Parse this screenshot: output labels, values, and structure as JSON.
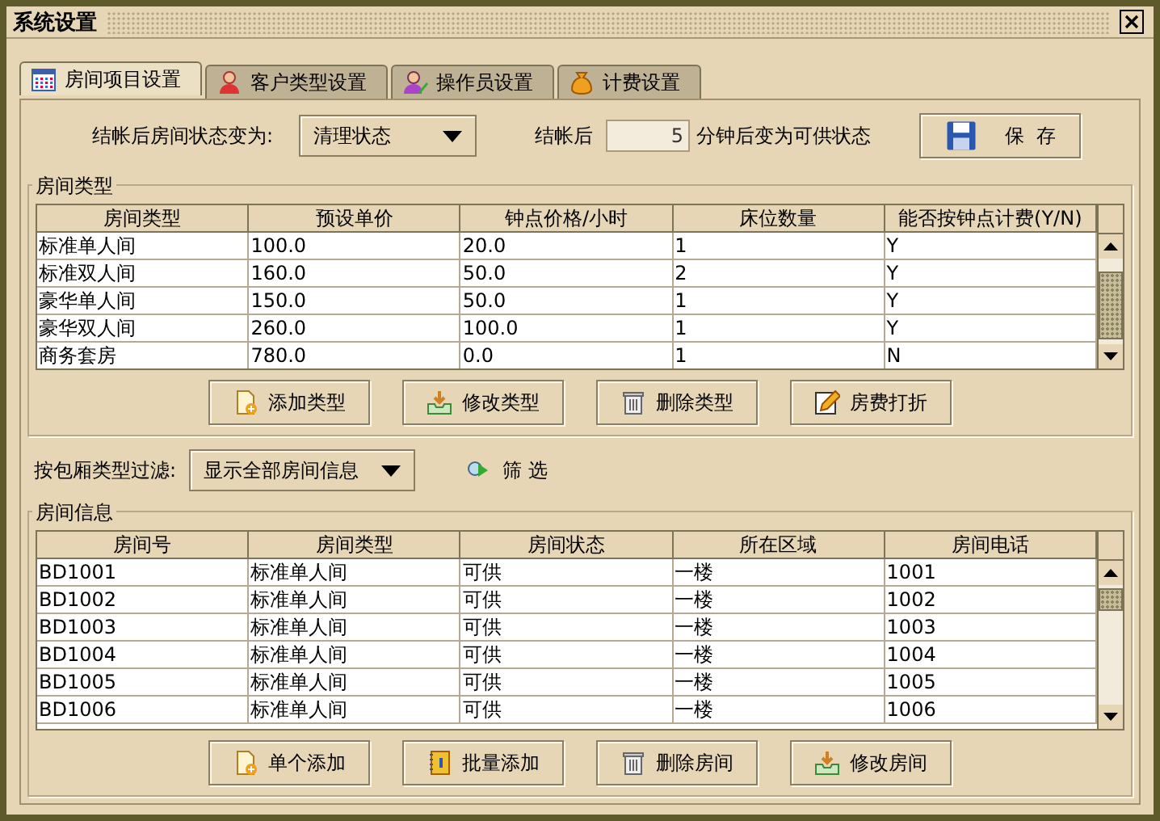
{
  "window": {
    "title": "系统设置"
  },
  "tabs": [
    {
      "label": "房间项目设置",
      "selected": true
    },
    {
      "label": "客户类型设置",
      "selected": false
    },
    {
      "label": "操作员设置",
      "selected": false
    },
    {
      "label": "计费设置",
      "selected": false
    }
  ],
  "checkout": {
    "status_label": "结帐后房间状态变为:",
    "status_value": "清理状态",
    "minutes_prefix": "结帐后",
    "minutes_value": "5",
    "minutes_suffix": "分钟后变为可供状态",
    "save_button": "保  存"
  },
  "room_types": {
    "title": "房间类型",
    "columns": [
      "房间类型",
      "预设单价",
      "钟点价格/小时",
      "床位数量",
      "能否按钟点计费(Y/N)"
    ],
    "rows": [
      [
        "标准单人间",
        "100.0",
        "20.0",
        "1",
        "Y"
      ],
      [
        "标准双人间",
        "160.0",
        "50.0",
        "2",
        "Y"
      ],
      [
        "豪华单人间",
        "150.0",
        "50.0",
        "1",
        "Y"
      ],
      [
        "豪华双人间",
        "260.0",
        "100.0",
        "1",
        "Y"
      ],
      [
        "商务套房",
        "780.0",
        "0.0",
        "1",
        "N"
      ]
    ],
    "buttons": [
      "添加类型",
      "修改类型",
      "删除类型",
      "房费打折"
    ]
  },
  "filter": {
    "label": "按包厢类型过滤:",
    "value": "显示全部房间信息",
    "button": "筛 选"
  },
  "rooms": {
    "title": "房间信息",
    "columns": [
      "房间号",
      "房间类型",
      "房间状态",
      "所在区域",
      "房间电话"
    ],
    "rows": [
      [
        "BD1001",
        "标准单人间",
        "可供",
        "一楼",
        "1001"
      ],
      [
        "BD1002",
        "标准单人间",
        "可供",
        "一楼",
        "1002"
      ],
      [
        "BD1003",
        "标准单人间",
        "可供",
        "一楼",
        "1003"
      ],
      [
        "BD1004",
        "标准单人间",
        "可供",
        "一楼",
        "1004"
      ],
      [
        "BD1005",
        "标准单人间",
        "可供",
        "一楼",
        "1005"
      ],
      [
        "BD1006",
        "标准单人间",
        "可供",
        "一楼",
        "1006"
      ]
    ],
    "buttons": [
      "单个添加",
      "批量添加",
      "删除房间",
      "修改房间"
    ]
  }
}
